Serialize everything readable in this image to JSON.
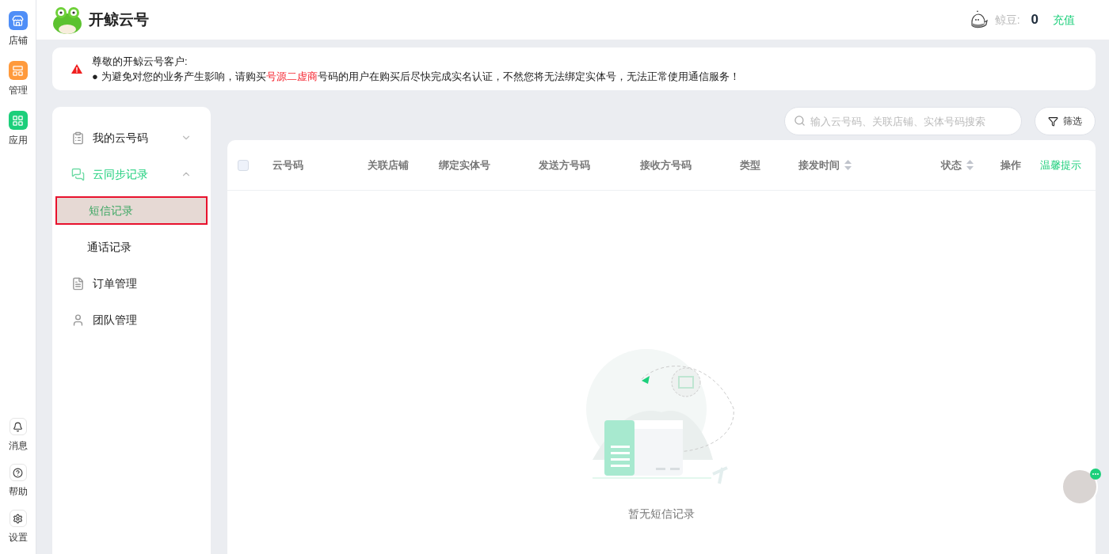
{
  "rail": {
    "top": [
      {
        "label": "店铺"
      },
      {
        "label": "管理"
      },
      {
        "label": "应用"
      }
    ],
    "bottom": [
      {
        "label": "消息"
      },
      {
        "label": "帮助"
      },
      {
        "label": "设置"
      }
    ]
  },
  "header": {
    "brand": "开鲸云号",
    "beans_label": "鲸豆:",
    "beans_value": "0",
    "recharge": "充值"
  },
  "notice": {
    "title": "尊敬的开鲸云号客户:",
    "bullet": "●",
    "segments": [
      {
        "text": "为避免对您的业务产生影响，请购买",
        "highlight": false
      },
      {
        "text": "号源二虚商",
        "highlight": true
      },
      {
        "text": "号码的用户在购买后尽快完成实名认证，不然您将无法绑定实体号，无法正常使用通信服务！",
        "highlight": false
      }
    ]
  },
  "menu": [
    {
      "label": "我的云号码",
      "expanded": false,
      "selected": false
    },
    {
      "label": "云同步记录",
      "expanded": true,
      "selected": true,
      "children": [
        {
          "label": "短信记录",
          "selected": true
        },
        {
          "label": "通话记录",
          "selected": false
        }
      ]
    },
    {
      "label": "订单管理",
      "selected": false
    },
    {
      "label": "团队管理",
      "selected": false
    }
  ],
  "search": {
    "placeholder": "输入云号码、关联店铺、实体号码搜索"
  },
  "filter_button": "筛选",
  "table": {
    "select_all_checked": false,
    "columns": [
      {
        "label": "云号码",
        "sortable": false,
        "kind": "text"
      },
      {
        "label": "关联店铺",
        "sortable": false,
        "kind": "text"
      },
      {
        "label": "绑定实体号",
        "sortable": false,
        "kind": "text"
      },
      {
        "label": "发送方号码",
        "sortable": false,
        "kind": "text"
      },
      {
        "label": "接收方号码",
        "sortable": false,
        "kind": "text"
      },
      {
        "label": "类型",
        "sortable": false,
        "kind": "text"
      },
      {
        "label": "接发时间",
        "sortable": true,
        "kind": "text"
      },
      {
        "label": "状态",
        "sortable": true,
        "kind": "text"
      },
      {
        "label": "操作",
        "sortable": false,
        "kind": "text"
      },
      {
        "label": "温馨提示",
        "sortable": false,
        "kind": "link"
      }
    ],
    "empty_text": "暂无短信记录"
  }
}
